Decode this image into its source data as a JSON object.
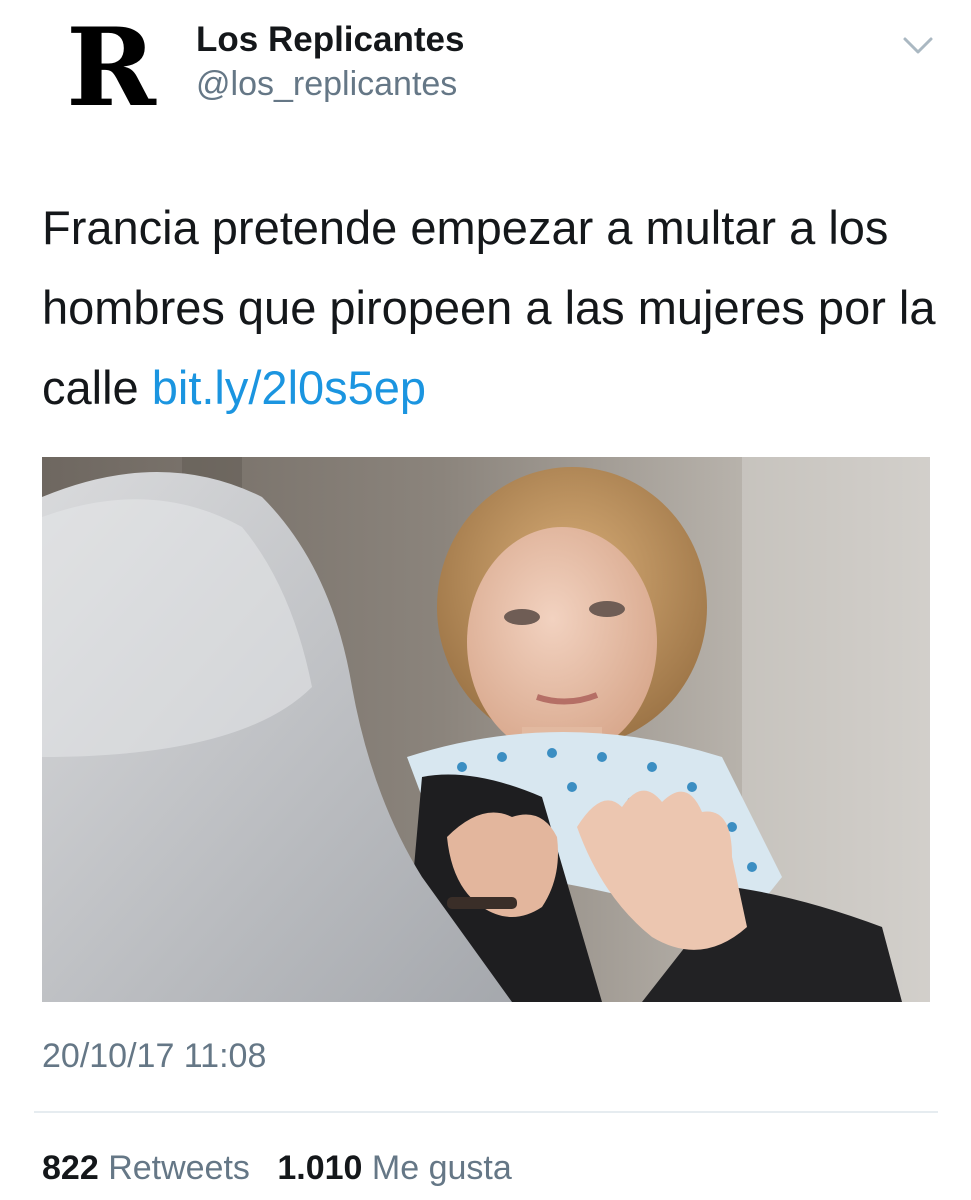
{
  "account": {
    "avatar_letter": "R",
    "display_name": "Los Replicantes",
    "handle": "@los_replicantes"
  },
  "tweet": {
    "text": "Francia pretende empezar a multar a los hombres que piropeen a las mujeres por la calle ",
    "link_text": "bit.ly/2l0s5ep",
    "timestamp": "20/10/17 11:08"
  },
  "stats": {
    "retweets_count": "822",
    "retweets_label": "Retweets",
    "likes_count": "1.010",
    "likes_label": "Me gusta"
  },
  "icons": {
    "menu": "chevron-down-icon"
  },
  "colors": {
    "link": "#1b95e0",
    "secondary_text": "#657786",
    "primary_text": "#14171a",
    "divider": "#e6ecf0"
  }
}
